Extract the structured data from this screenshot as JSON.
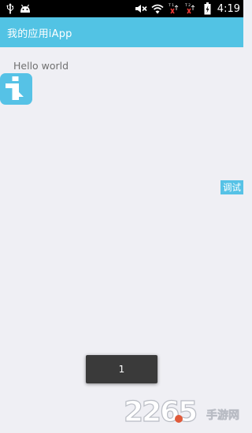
{
  "status_bar": {
    "time": "4:19",
    "left_icons": [
      "usb-icon",
      "android-debug-icon"
    ],
    "right_icons": [
      "mute-icon",
      "wifi-icon",
      "sim1-no-signal-icon",
      "sim2-no-signal-icon",
      "battery-charging-icon"
    ]
  },
  "action_bar": {
    "title": "我的应用iApp",
    "color": "#52c3e4"
  },
  "content": {
    "hello_text": "Hello world"
  },
  "floating": {
    "iapp_badge_icon": "iapp-logo-icon",
    "debug_label": "调试"
  },
  "toast": {
    "message": "1"
  },
  "watermark": {
    "brand_number": "2265",
    "brand_text": "手游网"
  }
}
